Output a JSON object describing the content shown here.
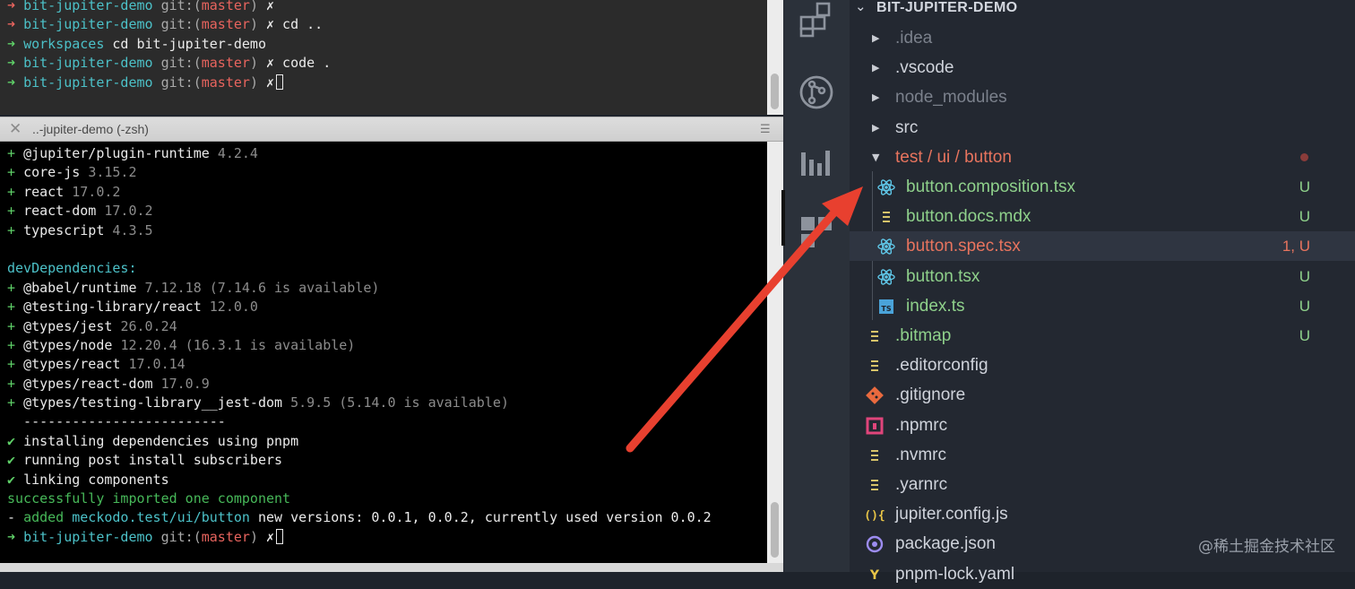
{
  "terminal_top": {
    "lines": [
      [
        {
          "t": "➜ ",
          "c": "c-rd"
        },
        {
          "t": "bit-jupiter-demo ",
          "c": "c-cy"
        },
        {
          "t": "git:(",
          "c": "c-dim"
        },
        {
          "t": "master",
          "c": "c-rd"
        },
        {
          "t": ") ",
          "c": "c-dim"
        },
        {
          "t": "✗",
          "c": "c-w"
        }
      ],
      [
        {
          "t": "➜ ",
          "c": "c-rd"
        },
        {
          "t": "bit-jupiter-demo ",
          "c": "c-cy"
        },
        {
          "t": "git:(",
          "c": "c-dim"
        },
        {
          "t": "master",
          "c": "c-rd"
        },
        {
          "t": ") ",
          "c": "c-dim"
        },
        {
          "t": "✗",
          "c": "c-w"
        },
        {
          "t": " cd ..",
          "c": "c-w"
        }
      ],
      [
        {
          "t": "➜ ",
          "c": "c-g"
        },
        {
          "t": "workspaces ",
          "c": "c-cy"
        },
        {
          "t": "cd bit-jupiter-demo",
          "c": "c-w"
        }
      ],
      [
        {
          "t": "➜ ",
          "c": "c-g"
        },
        {
          "t": "bit-jupiter-demo ",
          "c": "c-cy"
        },
        {
          "t": "git:(",
          "c": "c-dim"
        },
        {
          "t": "master",
          "c": "c-rd"
        },
        {
          "t": ") ",
          "c": "c-dim"
        },
        {
          "t": "✗",
          "c": "c-w"
        },
        {
          "t": " code .",
          "c": "c-w"
        }
      ],
      [
        {
          "t": "➜ ",
          "c": "c-g"
        },
        {
          "t": "bit-jupiter-demo ",
          "c": "c-cy"
        },
        {
          "t": "git:(",
          "c": "c-dim"
        },
        {
          "t": "master",
          "c": "c-rd"
        },
        {
          "t": ") ",
          "c": "c-dim"
        },
        {
          "t": "✗",
          "c": "c-w"
        },
        {
          "t": "",
          "c": "c-w",
          "cursor": true
        }
      ]
    ]
  },
  "tab": {
    "title": "..-jupiter-demo (-zsh)",
    "close": "✕",
    "menu": "☰"
  },
  "terminal_bottom": {
    "lines": [
      [
        {
          "t": "+ ",
          "c": "c-g"
        },
        {
          "t": "@jupiter/plugin-runtime ",
          "c": "c-w"
        },
        {
          "t": "4.2.4",
          "c": "c-gr"
        }
      ],
      [
        {
          "t": "+ ",
          "c": "c-g"
        },
        {
          "t": "core-js ",
          "c": "c-w"
        },
        {
          "t": "3.15.2",
          "c": "c-gr"
        }
      ],
      [
        {
          "t": "+ ",
          "c": "c-g"
        },
        {
          "t": "react ",
          "c": "c-w"
        },
        {
          "t": "17.0.2",
          "c": "c-gr"
        }
      ],
      [
        {
          "t": "+ ",
          "c": "c-g"
        },
        {
          "t": "react-dom ",
          "c": "c-w"
        },
        {
          "t": "17.0.2",
          "c": "c-gr"
        }
      ],
      [
        {
          "t": "+ ",
          "c": "c-g"
        },
        {
          "t": "typescript ",
          "c": "c-w"
        },
        {
          "t": "4.3.5",
          "c": "c-gr"
        }
      ],
      [],
      [
        {
          "t": "devDependencies:",
          "c": "c-cy"
        }
      ],
      [
        {
          "t": "+ ",
          "c": "c-g"
        },
        {
          "t": "@babel/runtime ",
          "c": "c-w"
        },
        {
          "t": "7.12.18 (7.14.6 is available)",
          "c": "c-gr"
        }
      ],
      [
        {
          "t": "+ ",
          "c": "c-g"
        },
        {
          "t": "@testing-library/react ",
          "c": "c-w"
        },
        {
          "t": "12.0.0",
          "c": "c-gr"
        }
      ],
      [
        {
          "t": "+ ",
          "c": "c-g"
        },
        {
          "t": "@types/jest ",
          "c": "c-w"
        },
        {
          "t": "26.0.24",
          "c": "c-gr"
        }
      ],
      [
        {
          "t": "+ ",
          "c": "c-g"
        },
        {
          "t": "@types/node ",
          "c": "c-w"
        },
        {
          "t": "12.20.4 (16.3.1 is available)",
          "c": "c-gr"
        }
      ],
      [
        {
          "t": "+ ",
          "c": "c-g"
        },
        {
          "t": "@types/react ",
          "c": "c-w"
        },
        {
          "t": "17.0.14",
          "c": "c-gr"
        }
      ],
      [
        {
          "t": "+ ",
          "c": "c-g"
        },
        {
          "t": "@types/react-dom ",
          "c": "c-w"
        },
        {
          "t": "17.0.9",
          "c": "c-gr"
        }
      ],
      [
        {
          "t": "+ ",
          "c": "c-g"
        },
        {
          "t": "@types/testing-library__jest-dom ",
          "c": "c-w"
        },
        {
          "t": "5.9.5 (5.14.0 is available)",
          "c": "c-gr"
        }
      ],
      [
        {
          "t": "  -------------------------",
          "c": "c-w"
        }
      ],
      [
        {
          "t": "✔ ",
          "c": "c-g"
        },
        {
          "t": "installing dependencies using pnpm",
          "c": "c-w"
        }
      ],
      [
        {
          "t": "✔ ",
          "c": "c-g"
        },
        {
          "t": "running post install subscribers",
          "c": "c-w"
        }
      ],
      [
        {
          "t": "✔ ",
          "c": "c-g"
        },
        {
          "t": "linking components",
          "c": "c-w"
        }
      ],
      [
        {
          "t": "successfully imported one component",
          "c": "c-dg"
        }
      ],
      [
        {
          "t": "- ",
          "c": "c-w"
        },
        {
          "t": "added ",
          "c": "c-dg"
        },
        {
          "t": "meckodo.test/ui/button",
          "c": "c-cy"
        },
        {
          "t": " new versions: 0.0.1, 0.0.2, currently used version 0.0.2",
          "c": "c-w"
        }
      ],
      [
        {
          "t": "➜ ",
          "c": "c-g"
        },
        {
          "t": "bit-jupiter-demo ",
          "c": "c-cy"
        },
        {
          "t": "git:(",
          "c": "c-dim"
        },
        {
          "t": "master",
          "c": "c-rd"
        },
        {
          "t": ") ",
          "c": "c-dim"
        },
        {
          "t": "✗",
          "c": "c-w"
        },
        {
          "t": "",
          "c": "c-w",
          "cursor": true
        }
      ]
    ]
  },
  "explorer": {
    "chevron": "⌄",
    "title": "BIT-JUPITER-DEMO",
    "items": [
      {
        "label": ".idea",
        "color": "#7b818c",
        "twisty": "▶"
      },
      {
        "label": ".vscode",
        "color": "#cfd3db",
        "twisty": "▶"
      },
      {
        "label": "node_modules",
        "color": "#7b818c",
        "twisty": "▶"
      },
      {
        "label": "src",
        "color": "#cfd3db",
        "twisty": "▶"
      },
      {
        "label": "test / ui / button",
        "color": "#e8745e",
        "twisty": "▼"
      },
      {
        "label": "button.composition.tsx",
        "color": "#8fd18b",
        "status": "U",
        "icon": "react-icon"
      },
      {
        "label": "button.docs.mdx",
        "color": "#8fd18b",
        "status": "U",
        "icon": "lines-icon"
      },
      {
        "label": "button.spec.tsx",
        "color": "#e8745e",
        "status": "1, U",
        "icon": "react-icon"
      },
      {
        "label": "button.tsx",
        "color": "#8fd18b",
        "status": "U",
        "icon": "react-icon"
      },
      {
        "label": "index.ts",
        "color": "#8fd18b",
        "status": "U",
        "icon": "typescript-icon"
      },
      {
        "label": ".bitmap",
        "color": "#8fd18b",
        "status": "U",
        "icon": "lines-icon"
      },
      {
        "label": ".editorconfig",
        "color": "#cfd3db",
        "icon": "lines-icon"
      },
      {
        "label": ".gitignore",
        "color": "#cfd3db",
        "icon": "git-icon"
      },
      {
        "label": ".npmrc",
        "color": "#cfd3db",
        "icon": "npm-icon"
      },
      {
        "label": ".nvmrc",
        "color": "#cfd3db",
        "icon": "lines-icon"
      },
      {
        "label": ".yarnrc",
        "color": "#cfd3db",
        "icon": "lines-icon"
      },
      {
        "label": "jupiter.config.js",
        "color": "#cfd3db",
        "icon": "js-config-icon"
      },
      {
        "label": "package.json",
        "color": "#cfd3db",
        "icon": "package-icon"
      },
      {
        "label": "pnpm-lock.yaml",
        "color": "#cfd3db",
        "icon": "yaml-icon"
      }
    ]
  },
  "activity_bar": [
    "extensions-icon",
    "source-control-icon",
    "analytics-icon",
    "blocks-icon"
  ],
  "watermark": "@稀土掘金技术社区",
  "colors": {
    "arrow": "#e8402f",
    "terminal_bg": "#000000",
    "explorer_bg": "#232831"
  }
}
